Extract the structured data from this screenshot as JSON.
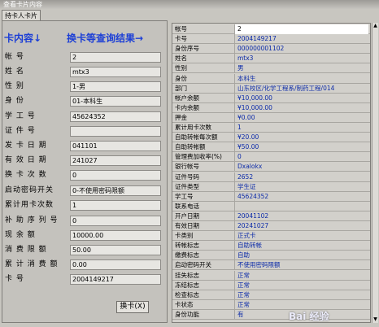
{
  "window": {
    "title": "查看卡片内容"
  },
  "tab": {
    "label": "持卡人卡片"
  },
  "annotations": {
    "left": "卡内容↓",
    "right": "换卡等查询结果→"
  },
  "left_fields": [
    {
      "label": "帐      号",
      "value": "2"
    },
    {
      "label": "姓      名",
      "value": "mtx3"
    },
    {
      "label": "性      别",
      "value": "1-男"
    },
    {
      "label": "身      份",
      "value": "01-本科生"
    },
    {
      "label": "学  工  号",
      "value": "45624352"
    },
    {
      "label": "证  件  号",
      "value": ""
    },
    {
      "label": "发 卡 日 期",
      "value": "041101"
    },
    {
      "label": "有 效 日 期",
      "value": "241027"
    },
    {
      "label": "换 卡 次 数",
      "value": "0"
    },
    {
      "label": "启动密码开关",
      "value": "0-不使用密码限额"
    },
    {
      "label": "累计用卡次数",
      "value": "1"
    },
    {
      "label": "补 助 序 列 号",
      "value": "0"
    },
    {
      "label": "现   余   额",
      "value": "10000.00"
    },
    {
      "label": "消 费 限 额",
      "value": "50.00"
    },
    {
      "label": "累 计 消 费 额",
      "value": "0.00"
    },
    {
      "label": "卡      号",
      "value": "2004149217"
    }
  ],
  "swap_button": {
    "label": "换卡(X)"
  },
  "right_rows": [
    {
      "label": "帐号",
      "value": "2"
    },
    {
      "label": "卡号",
      "value": "2004149217"
    },
    {
      "label": "身份序号",
      "value": "000000001102"
    },
    {
      "label": "姓名",
      "value": "mtx3"
    },
    {
      "label": "性别",
      "value": "男"
    },
    {
      "label": "身份",
      "value": "本科生"
    },
    {
      "label": "部门",
      "value": "山东校区/化学工程系/制药工程/014"
    },
    {
      "label": "帐户余额",
      "value": "¥10,000.00"
    },
    {
      "label": "卡内余额",
      "value": "¥10,000.00"
    },
    {
      "label": "押金",
      "value": "¥0.00"
    },
    {
      "label": "累计用卡次数",
      "value": "1"
    },
    {
      "label": "自助转帐每次额",
      "value": "¥20.00"
    },
    {
      "label": "自助转帐额",
      "value": "¥50.00"
    },
    {
      "label": "管理费加收率(%)",
      "value": "0"
    },
    {
      "label": "银行帐号",
      "value": "Dxalokx"
    },
    {
      "label": "证件号码",
      "value": "2652"
    },
    {
      "label": "证件类型",
      "value": "学生证"
    },
    {
      "label": "学工号",
      "value": "45624352"
    },
    {
      "label": "联系电话",
      "value": ""
    },
    {
      "label": "开户日期",
      "value": "20041102"
    },
    {
      "label": "有效日期",
      "value": "20241027"
    },
    {
      "label": "卡类别",
      "value": "正式卡"
    },
    {
      "label": "转帐标志",
      "value": "自助转帐"
    },
    {
      "label": "缴费标志",
      "value": "自助"
    },
    {
      "label": "启动密码开关",
      "value": "不使用密码限额"
    },
    {
      "label": "挂失标志",
      "value": "正常"
    },
    {
      "label": "冻结标志",
      "value": "正常"
    },
    {
      "label": "检查标志",
      "value": "正常"
    },
    {
      "label": "卡状态",
      "value": "正常"
    },
    {
      "label": "身份功能",
      "value": "有"
    }
  ],
  "watermark": "Bai 经验"
}
